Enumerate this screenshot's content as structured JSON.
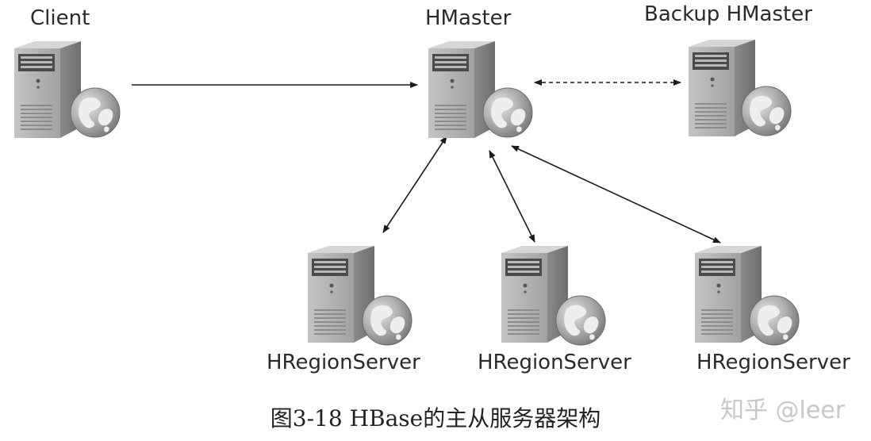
{
  "nodes": {
    "client": "Client",
    "hmaster": "HMaster",
    "backup": "Backup HMaster",
    "region1": "HRegionServer",
    "region2": "HRegionServer",
    "region3": "HRegionServer"
  },
  "caption": "图3-18  HBase的主从服务器架构",
  "watermark": "知乎 @leer",
  "icons": {
    "server": "server-tower-icon",
    "globe": "globe-icon"
  }
}
